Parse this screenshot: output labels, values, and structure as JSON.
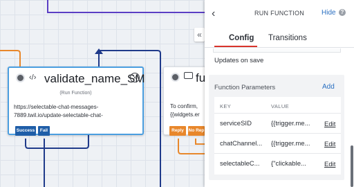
{
  "canvas": {
    "node_validate": {
      "title": "validate_name_SM",
      "subtitle": "(Run Function)",
      "url_line1": "https://selectable-chat-messages-",
      "url_line2": "7889.twil.io/update-selectable-chat-",
      "transitions": [
        "Success",
        "Fail"
      ]
    },
    "node_function": {
      "title": "fu",
      "body_line1": "To confirm,",
      "body_line2": "{{widgets.er",
      "transitions": [
        "Reply",
        "No Rep"
      ]
    },
    "collapse_label": "«"
  },
  "panel": {
    "back_label": "‹",
    "title": "RUN FUNCTION",
    "hide_label": "Hide",
    "help_label": "?",
    "tabs": [
      {
        "label": "Config",
        "active": true
      },
      {
        "label": "Transitions",
        "active": false
      }
    ],
    "updates_text": "Updates on save",
    "params": {
      "title": "Function Parameters",
      "add_label": "Add",
      "columns": [
        "KEY",
        "VALUE"
      ],
      "rows": [
        {
          "key": "serviceSID",
          "value": "{{trigger.me...",
          "action": "Edit"
        },
        {
          "key": "chatChannel...",
          "value": "{{trigger.me...",
          "action": "Edit"
        },
        {
          "key": "selectableC...",
          "value": "{\"clickable...",
          "action": "Edit"
        }
      ]
    }
  },
  "colors": {
    "accent": "#2a6fc1",
    "tab_active": "#d9342b",
    "wire_orange": "#e8872b",
    "wire_navy": "#1f3a8a",
    "wire_purple": "#5b3fc4",
    "selected_border": "#4a9ee0"
  }
}
